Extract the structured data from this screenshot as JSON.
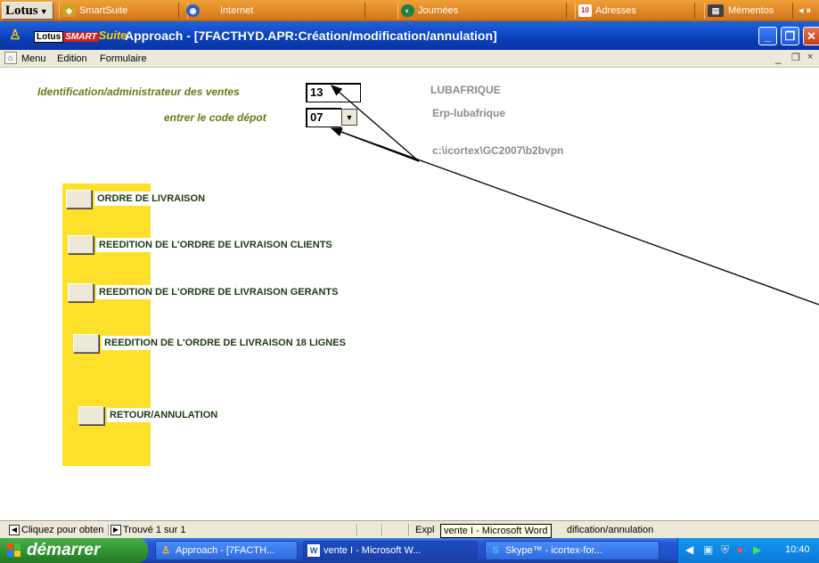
{
  "smartcenter": {
    "menu_label": "Lotus",
    "drawers": [
      "SmartSuite",
      "Internet",
      "Journées",
      "Adresses",
      "Mémentos"
    ],
    "calendar_day": "10"
  },
  "window": {
    "logo_lotus": "Lotus",
    "logo_smart": "SMART",
    "logo_suite": "Suite",
    "title": "Approach - [7FACTHYD.APR:Création/modification/annulation]"
  },
  "menu": {
    "items": [
      "Menu",
      "Edition",
      "Formulaire"
    ]
  },
  "form": {
    "id_label": "Identification/administrateur des ventes",
    "id_value": "13",
    "depot_label": "entrer le code dépot",
    "depot_value": "07",
    "company_name": "LUBAFRIQUE",
    "erp_name": "Erp-lubafrique",
    "path": "c:\\icortex\\GC2007\\b2bvpn",
    "buttons": [
      "ORDRE DE LIVRAISON",
      "REEDITION DE L'ORDRE DE LIVRAISON  CLIENTS",
      "REEDITION DE L'ORDRE DE LIVRAISON GERANTS",
      "REEDITION DE L'ORDRE DE LIVRAISON  18 LIGNES",
      "RETOUR/ANNULATION"
    ]
  },
  "status": {
    "help": "Cliquez pour obten",
    "found": "Trouvé 1 sur 1",
    "mode_prefix": "Expl",
    "mode_suffix": "dification/annulation",
    "tooltip": "vente I - Microsoft Word"
  },
  "taskbar": {
    "start": "démarrer",
    "tasks": [
      "Approach - [7FACTH...",
      "vente I - Microsoft W...",
      "Skype™ - icortex-for..."
    ],
    "clock": "10:40"
  },
  "colors": {
    "panel_yellow": "#fde02a",
    "label_olive": "#6a7a18",
    "title_blue": "#0a3fb8"
  }
}
